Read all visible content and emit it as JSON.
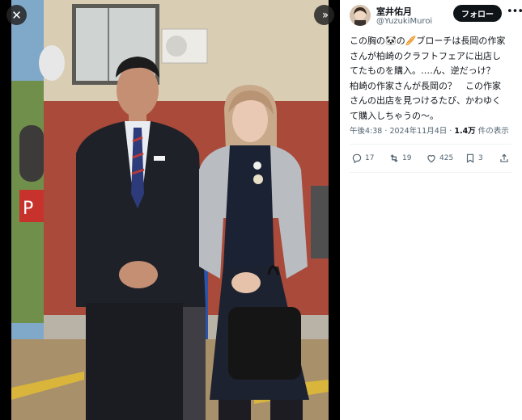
{
  "viewer": {
    "close_icon": "close-icon",
    "expand_icon": "double-chevron-right-icon"
  },
  "author": {
    "display_name": "室井佑月",
    "handle": "@YuzukiMuroi"
  },
  "follow_label": "フォロー",
  "more_icon": "more-icon",
  "tweet": {
    "lines": [
      "この胸の🐼の🥖ブローチは長岡の作家",
      "さんが柏崎のクラフトフェアに出店し",
      "てたものを購入。‥‥ん、逆だっけ？",
      "柏崎の作家さんが長岡の？　この作家",
      "さんの出店を見つけるたび、かわゆく",
      "て購入しちゃうの〜。"
    ]
  },
  "meta": {
    "time": "午後4:38",
    "separator": "·",
    "date": "2024年11月4日",
    "views": "1.4万",
    "views_suffix": "件の表示"
  },
  "actions": {
    "replies": "17",
    "reposts": "19",
    "likes": "425",
    "bookmarks": "3"
  }
}
